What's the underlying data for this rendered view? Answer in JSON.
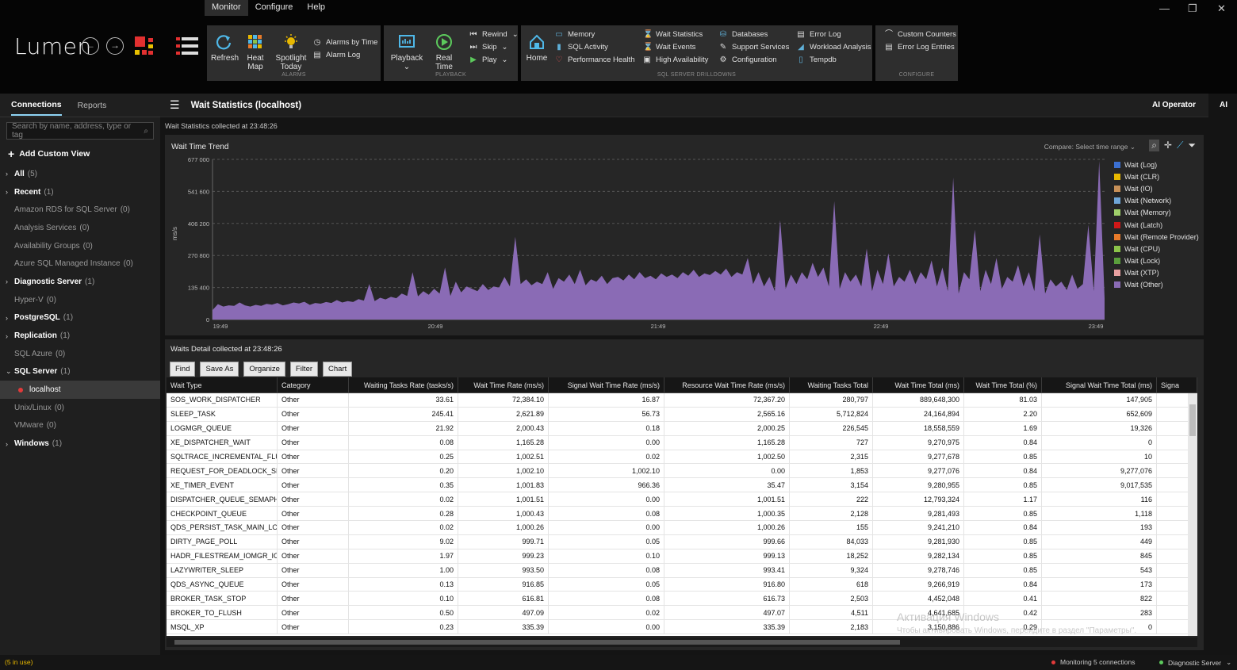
{
  "app": {
    "logo": "Lumen"
  },
  "menu": [
    "Monitor",
    "Configure",
    "Help"
  ],
  "ribbon": {
    "alarms": {
      "label": "ALARMS",
      "refresh": "Refresh",
      "heatmap": "Heat Map",
      "spotlight1": "Spotlight",
      "spotlight2": "Today",
      "alarms_by_time": "Alarms by Time",
      "alarm_log": "Alarm Log"
    },
    "playback": {
      "label": "PLAYBACK",
      "playback": "Playback",
      "real_time": "Real Time",
      "rewind": "Rewind",
      "skip": "Skip",
      "play": "Play"
    },
    "drilldowns": {
      "label": "SQL SERVER DRILLDOWNS",
      "home": "Home",
      "memory": "Memory",
      "sql_activity": "SQL Activity",
      "performance_health": "Performance Health",
      "wait_statistics": "Wait Statistics",
      "wait_events": "Wait Events",
      "high_availability": "High Availability",
      "databases": "Databases",
      "support_services": "Support Services",
      "configuration": "Configuration",
      "error_log": "Error Log",
      "workload_analysis": "Workload Analysis",
      "tempdb": "Tempdb"
    },
    "configure": {
      "label": "CONFIGURE",
      "custom_counters": "Custom Counters",
      "error_log_entries": "Error Log Entries"
    }
  },
  "sidebar": {
    "tabs": [
      "Connections",
      "Reports"
    ],
    "search_placeholder": "Search by name, address, type or tag",
    "add_custom_view": "Add Custom View",
    "items": [
      {
        "name": "All",
        "count": "(5)",
        "bold": true,
        "chev": "›"
      },
      {
        "name": "Recent",
        "count": "(1)",
        "bold": true,
        "chev": "›"
      },
      {
        "name": "Amazon RDS for SQL Server",
        "count": "(0)",
        "bold": false,
        "chev": ""
      },
      {
        "name": "Analysis Services",
        "count": "(0)",
        "bold": false,
        "chev": ""
      },
      {
        "name": "Availability Groups",
        "count": "(0)",
        "bold": false,
        "chev": ""
      },
      {
        "name": "Azure SQL Managed Instance",
        "count": "(0)",
        "bold": false,
        "chev": ""
      },
      {
        "name": "Diagnostic Server",
        "count": "(1)",
        "bold": true,
        "chev": "›"
      },
      {
        "name": "Hyper-V",
        "count": "(0)",
        "bold": false,
        "chev": ""
      },
      {
        "name": "PostgreSQL",
        "count": "(1)",
        "bold": true,
        "chev": "›"
      },
      {
        "name": "Replication",
        "count": "(1)",
        "bold": true,
        "chev": "›"
      },
      {
        "name": "SQL Azure",
        "count": "(0)",
        "bold": false,
        "chev": ""
      },
      {
        "name": "SQL Server",
        "count": "(1)",
        "bold": true,
        "chev": "⌄"
      },
      {
        "name": "localhost",
        "count": "",
        "bold": false,
        "chev": "",
        "child": true
      },
      {
        "name": "Unix/Linux",
        "count": "(0)",
        "bold": false,
        "chev": ""
      },
      {
        "name": "VMware",
        "count": "(0)",
        "bold": false,
        "chev": ""
      },
      {
        "name": "Windows",
        "count": "(1)",
        "bold": true,
        "chev": "›"
      }
    ]
  },
  "main": {
    "title": "Wait Statistics (localhost)",
    "ai_operator": "AI Operator",
    "ai_short": "AI",
    "collected": "Wait Statistics collected at 23:48:26",
    "chart_title": "Wait Time Trend",
    "compare": "Compare: Select time range ⌄",
    "detail_collected": "Waits Detail collected at 23:48:26",
    "buttons": [
      "Find",
      "Save As",
      "Organize",
      "Filter",
      "Chart"
    ]
  },
  "chart_data": {
    "type": "area",
    "title": "Wait Time Trend",
    "ylabel": "ms/s",
    "ylim": [
      0,
      677000
    ],
    "yticks": [
      "677 000",
      "541 600",
      "406 200",
      "270 800",
      "135 400",
      "0"
    ],
    "xticks": [
      "19:49",
      "20:49",
      "21:49",
      "22:49",
      "23:49"
    ],
    "legend": [
      {
        "name": "Wait (Log)",
        "color": "#3b6fd1"
      },
      {
        "name": "Wait (CLR)",
        "color": "#e8b800"
      },
      {
        "name": "Wait (IO)",
        "color": "#c79058"
      },
      {
        "name": "Wait (Network)",
        "color": "#6fa6d8"
      },
      {
        "name": "Wait (Memory)",
        "color": "#9fcf6a"
      },
      {
        "name": "Wait (Latch)",
        "color": "#d01818"
      },
      {
        "name": "Wait (Remote Provider)",
        "color": "#e87a2a"
      },
      {
        "name": "Wait (CPU)",
        "color": "#8bc34a"
      },
      {
        "name": "Wait (Lock)",
        "color": "#5a9e3c"
      },
      {
        "name": "Wait (XTP)",
        "color": "#e8a0a0"
      },
      {
        "name": "Wait (Other)",
        "color": "#8a6bb5"
      }
    ],
    "series": [
      {
        "name": "Wait (Other)",
        "color": "#8a6bb5",
        "values": [
          40000,
          65000,
          55000,
          60000,
          58000,
          72000,
          60000,
          55000,
          62000,
          58000,
          66000,
          63000,
          70000,
          60000,
          65000,
          72000,
          68000,
          75000,
          62000,
          70000,
          67000,
          74000,
          70000,
          82000,
          72000,
          78000,
          74000,
          86000,
          80000,
          150000,
          78000,
          92000,
          85000,
          96000,
          90000,
          110000,
          100000,
          200000,
          98000,
          120000,
          105000,
          130000,
          110000,
          220000,
          100000,
          160000,
          115000,
          140000,
          130000,
          120000,
          150000,
          125000,
          140000,
          135000,
          180000,
          140000,
          350000,
          150000,
          170000,
          145000,
          160000,
          150000,
          200000,
          130000,
          175000,
          160000,
          190000,
          150000,
          210000,
          145000,
          170000,
          160000,
          185000,
          150000,
          175000,
          180000,
          165000,
          190000,
          170000,
          200000,
          175000,
          185000,
          170000,
          195000,
          180000,
          190000,
          175000,
          200000,
          185000,
          210000,
          180000,
          195000,
          188000,
          205000,
          190000,
          215000,
          180000,
          200000,
          190000,
          260000,
          150000,
          200000,
          140000,
          180000,
          120000,
          420000,
          130000,
          190000,
          150000,
          200000,
          170000,
          240000,
          180000,
          220000,
          140000,
          500000,
          130000,
          200000,
          160000,
          190000,
          140000,
          300000,
          120000,
          210000,
          150000,
          280000,
          140000,
          180000,
          160000,
          210000,
          150000,
          200000,
          170000,
          250000,
          140000,
          220000,
          120000,
          600000,
          110000,
          200000,
          170000,
          380000,
          120000,
          210000,
          150000,
          260000,
          130000,
          180000,
          160000,
          230000,
          140000,
          200000,
          120000,
          360000,
          110000,
          170000,
          140000,
          160000,
          125000,
          190000,
          130000,
          150000,
          400000,
          120000,
          670000,
          90000
        ]
      }
    ]
  },
  "table": {
    "columns": [
      "Wait Type",
      "Category",
      "Waiting Tasks Rate (tasks/s)",
      "Wait Time Rate (ms/s)",
      "Signal Wait Time Rate (ms/s)",
      "Resource Wait Time Rate (ms/s)",
      "Waiting Tasks Total",
      "Wait Time Total (ms)",
      "Wait Time Total (%)",
      "Signal Wait Time Total (ms)",
      "Signa"
    ],
    "rows": [
      [
        "SOS_WORK_DISPATCHER",
        "Other",
        "33.61",
        "72,384.10",
        "16.87",
        "72,367.20",
        "280,797",
        "889,648,300",
        "81.03",
        "147,905",
        ""
      ],
      [
        "SLEEP_TASK",
        "Other",
        "245.41",
        "2,621.89",
        "56.73",
        "2,565.16",
        "5,712,824",
        "24,164,894",
        "2.20",
        "652,609",
        ""
      ],
      [
        "LOGMGR_QUEUE",
        "Other",
        "21.92",
        "2,000.43",
        "0.18",
        "2,000.25",
        "226,545",
        "18,558,559",
        "1.69",
        "19,326",
        ""
      ],
      [
        "XE_DISPATCHER_WAIT",
        "Other",
        "0.08",
        "1,165.28",
        "0.00",
        "1,165.28",
        "727",
        "9,270,975",
        "0.84",
        "0",
        ""
      ],
      [
        "SQLTRACE_INCREMENTAL_FLUSH_",
        "Other",
        "0.25",
        "1,002.51",
        "0.02",
        "1,002.50",
        "2,315",
        "9,277,678",
        "0.85",
        "10",
        ""
      ],
      [
        "REQUEST_FOR_DEADLOCK_SEARC",
        "Other",
        "0.20",
        "1,002.10",
        "1,002.10",
        "0.00",
        "1,853",
        "9,277,076",
        "0.84",
        "9,277,076",
        ""
      ],
      [
        "XE_TIMER_EVENT",
        "Other",
        "0.35",
        "1,001.83",
        "966.36",
        "35.47",
        "3,154",
        "9,280,955",
        "0.85",
        "9,017,535",
        ""
      ],
      [
        "DISPATCHER_QUEUE_SEMAPHORI",
        "Other",
        "0.02",
        "1,001.51",
        "0.00",
        "1,001.51",
        "222",
        "12,793,324",
        "1.17",
        "116",
        ""
      ],
      [
        "CHECKPOINT_QUEUE",
        "Other",
        "0.28",
        "1,000.43",
        "0.08",
        "1,000.35",
        "2,128",
        "9,281,493",
        "0.85",
        "1,118",
        ""
      ],
      [
        "QDS_PERSIST_TASK_MAIN_LOOP_",
        "Other",
        "0.02",
        "1,000.26",
        "0.00",
        "1,000.26",
        "155",
        "9,241,210",
        "0.84",
        "193",
        ""
      ],
      [
        "DIRTY_PAGE_POLL",
        "Other",
        "9.02",
        "999.71",
        "0.05",
        "999.66",
        "84,033",
        "9,281,930",
        "0.85",
        "449",
        ""
      ],
      [
        "HADR_FILESTREAM_IOMGR_IOCO",
        "Other",
        "1.97",
        "999.23",
        "0.10",
        "999.13",
        "18,252",
        "9,282,134",
        "0.85",
        "845",
        ""
      ],
      [
        "LAZYWRITER_SLEEP",
        "Other",
        "1.00",
        "993.50",
        "0.08",
        "993.41",
        "9,324",
        "9,278,746",
        "0.85",
        "543",
        ""
      ],
      [
        "QDS_ASYNC_QUEUE",
        "Other",
        "0.13",
        "916.85",
        "0.05",
        "916.80",
        "618",
        "9,266,919",
        "0.84",
        "173",
        ""
      ],
      [
        "BROKER_TASK_STOP",
        "Other",
        "0.10",
        "616.81",
        "0.08",
        "616.73",
        "2,503",
        "4,452,048",
        "0.41",
        "822",
        ""
      ],
      [
        "BROKER_TO_FLUSH",
        "Other",
        "0.50",
        "497.09",
        "0.02",
        "497.07",
        "4,511",
        "4,641,685",
        "0.42",
        "283",
        ""
      ],
      [
        "MSQL_XP",
        "Other",
        "0.23",
        "335.39",
        "0.00",
        "335.39",
        "2,183",
        "3,150,886",
        "0.29",
        "0",
        ""
      ]
    ]
  },
  "status": {
    "left": "(5 in use)",
    "monitoring": "Monitoring 5 connections",
    "diag": "Diagnostic Server"
  },
  "watermark": {
    "line1": "Активация Windows",
    "line2": "Чтобы активировать Windows, перейдите в раздел \"Параметры\"."
  }
}
